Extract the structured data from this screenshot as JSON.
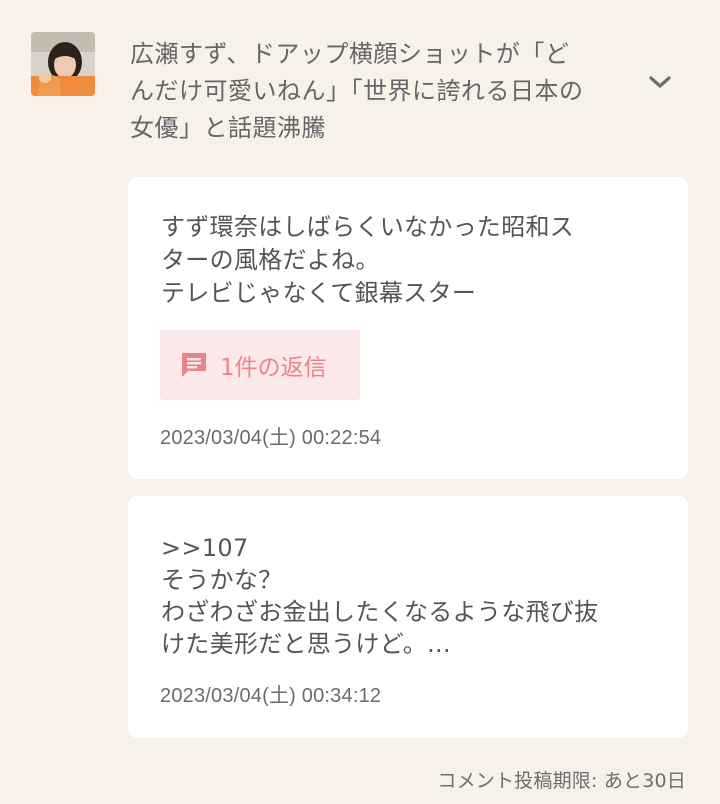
{
  "article": {
    "title": "広瀬すず、ドアップ横顔ショットが「どんだけ可愛いねん」「世界に誇れる日本の女優」と話題沸騰",
    "thumbnail_icon": "article-thumbnail",
    "expand_icon": "chevron-down-icon"
  },
  "comments": [
    {
      "text": "すず環奈はしばらくいなかった昭和ス\nターの風格だよね。\nテレビじゃなくて銀幕スター",
      "reply_label": "1件の返信",
      "reply_icon": "comment-icon",
      "timestamp": "2023/03/04(土) 00:22:54"
    },
    {
      "text": ">>107\nそうかな？\nわざわざお金出したくなるような飛び抜\nけた美形だと思うけど。...",
      "timestamp": "2023/03/04(土) 00:34:12"
    }
  ],
  "footer": {
    "deadline": "コメント投稿期限: あと30日"
  },
  "colors": {
    "background": "#f7f1e8",
    "card": "#ffffff",
    "reply_bg": "#fbe9e9",
    "reply_accent": "#e7858b"
  }
}
